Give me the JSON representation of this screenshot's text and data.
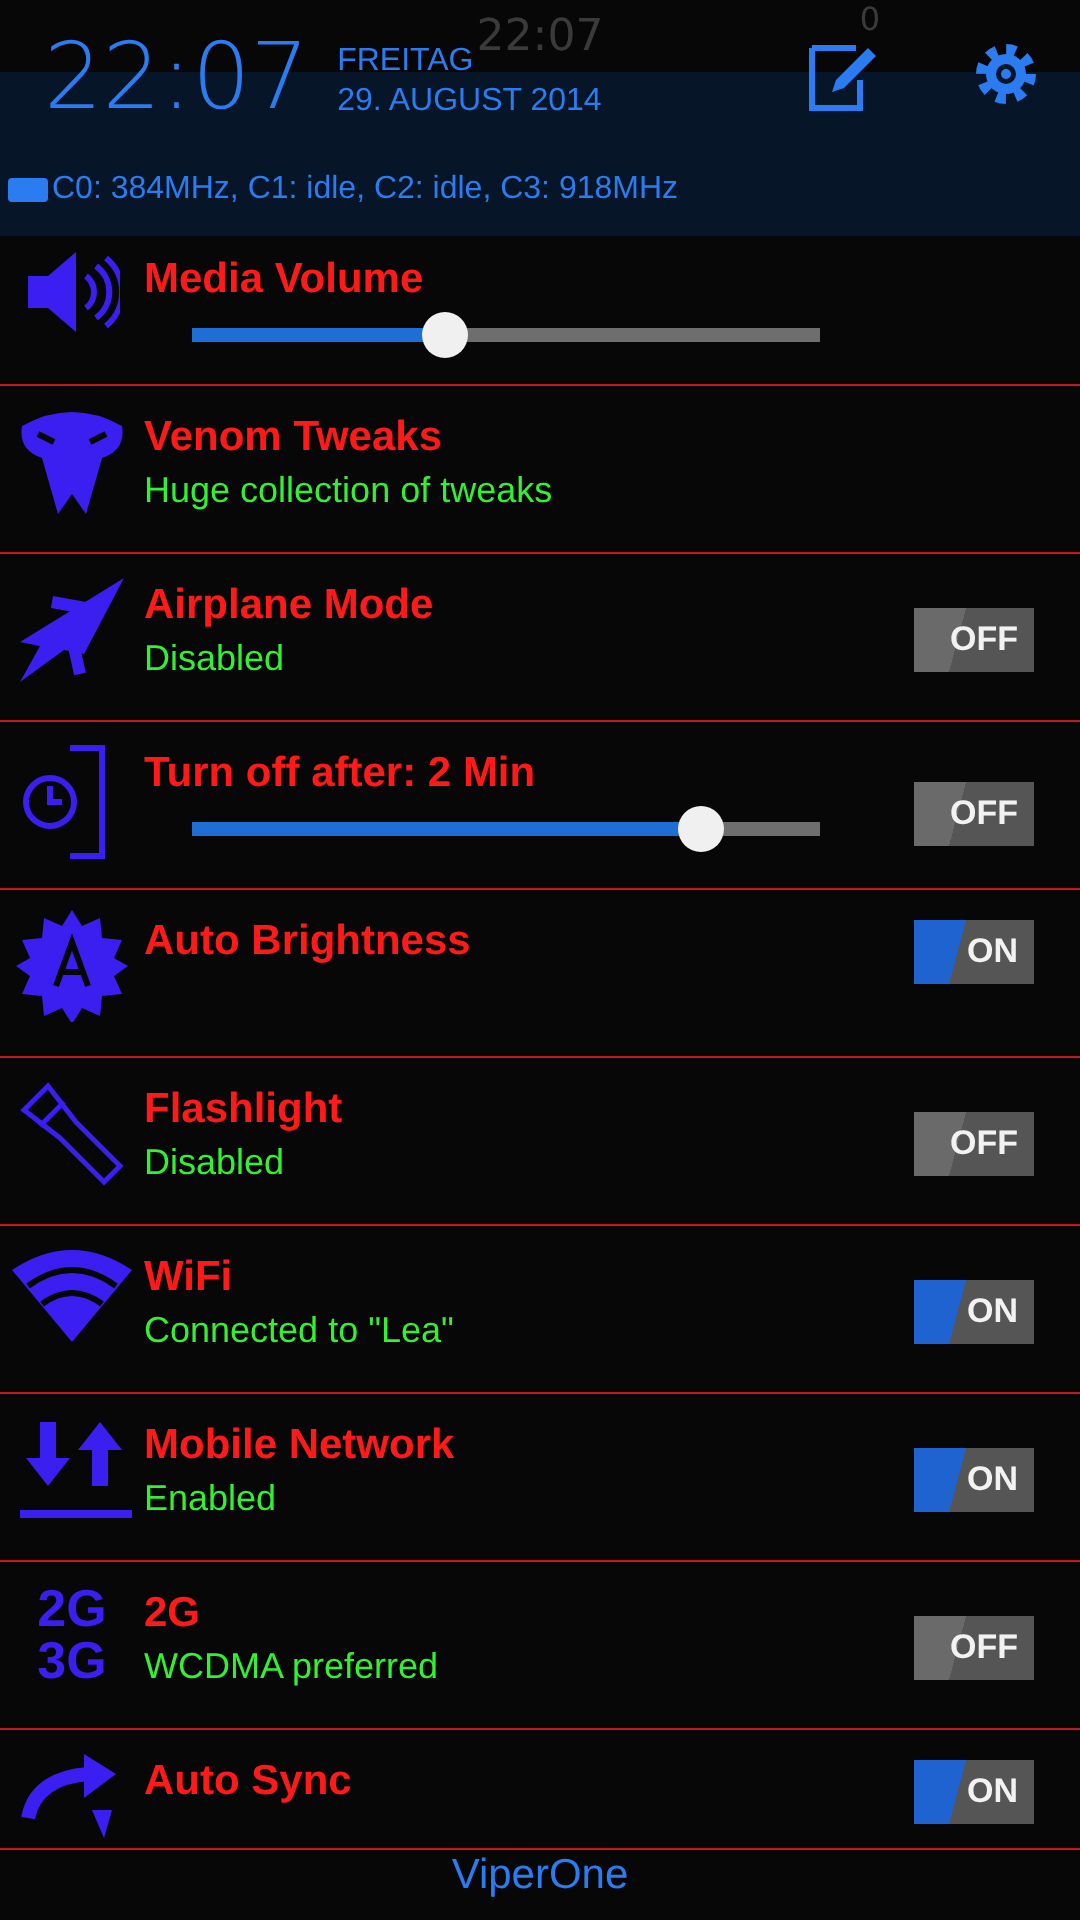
{
  "status_bar": {
    "time": "22:07",
    "speed": "0"
  },
  "header": {
    "clock": "22:07",
    "weekday": "FREITAG",
    "date": "29. AUGUST 2014",
    "cpu": "C0: 384MHz, C1: idle, C2: idle, C3: 918MHz"
  },
  "items": [
    {
      "kind": "slider",
      "title": "Media Volume",
      "level": 0.4
    },
    {
      "kind": "link",
      "title": "Venom Tweaks",
      "subtitle": "Huge collection of tweaks"
    },
    {
      "kind": "toggle",
      "title": "Airplane Mode",
      "subtitle": "Disabled",
      "on": false,
      "switch_label": "OFF"
    },
    {
      "kind": "slider",
      "title": "Turn off after: 2 Min",
      "level": 0.81,
      "on": false,
      "switch_label": "OFF"
    },
    {
      "kind": "toggle",
      "title": "Auto Brightness",
      "on": true,
      "switch_label": "ON"
    },
    {
      "kind": "toggle",
      "title": "Flashlight",
      "subtitle": "Disabled",
      "on": false,
      "switch_label": "OFF"
    },
    {
      "kind": "toggle",
      "title": "WiFi",
      "subtitle": "Connected to \"Lea\"",
      "on": true,
      "switch_label": "ON"
    },
    {
      "kind": "toggle",
      "title": "Mobile Network",
      "subtitle": "Enabled",
      "on": true,
      "switch_label": "ON"
    },
    {
      "kind": "toggle",
      "title": "2G",
      "subtitle": "WCDMA preferred",
      "on": false,
      "switch_label": "OFF",
      "icon_text": [
        "2G",
        "3G"
      ]
    },
    {
      "kind": "toggle",
      "title": "Auto Sync",
      "on": true,
      "switch_label": "ON"
    }
  ],
  "footer": "ViperOne"
}
